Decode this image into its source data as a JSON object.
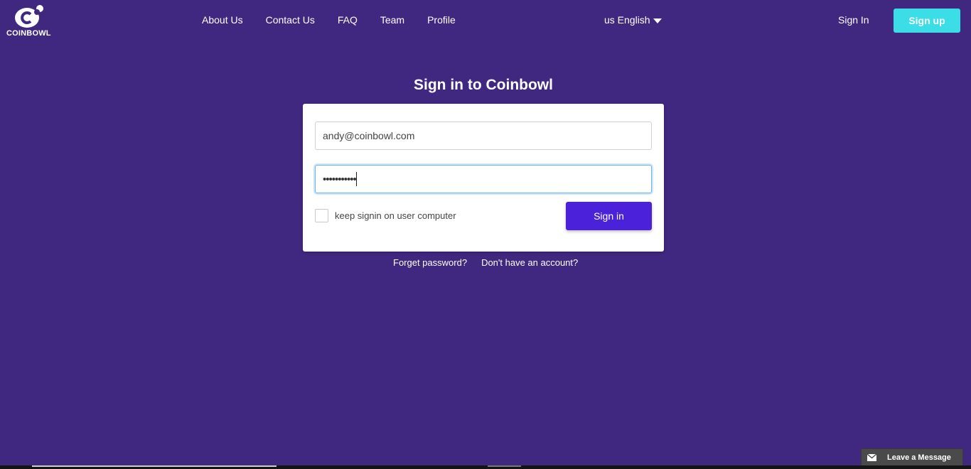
{
  "header": {
    "logo_text": "COINBOWL",
    "nav": [
      {
        "label": "About Us"
      },
      {
        "label": "Contact Us"
      },
      {
        "label": "FAQ"
      },
      {
        "label": "Team"
      },
      {
        "label": "Profile"
      }
    ],
    "language": "us English",
    "signin_label": "Sign In",
    "signup_label": "Sign up"
  },
  "main": {
    "title": "Sign in to Coinbowl",
    "email_value": "andy@coinbowl.com",
    "password_value": "•••••••••••",
    "keep_signin_label": "keep signin on user computer",
    "signin_button": "Sign in",
    "forget_password": "Forget password?",
    "no_account": "Don't have an account?"
  },
  "widget": {
    "label": "Leave a Message"
  },
  "colors": {
    "background": "#40277f",
    "signup": "#3bdde6",
    "primary": "#4b22d9"
  },
  "icons": {
    "logo": "coinbowl-logo-icon",
    "language_caret": "caret-down-icon",
    "message": "envelope-icon"
  }
}
